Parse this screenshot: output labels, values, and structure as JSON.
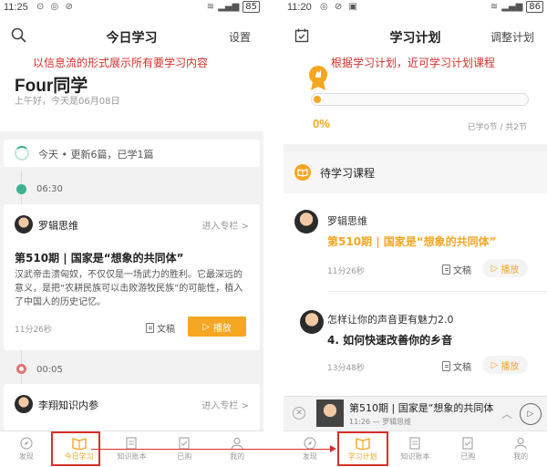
{
  "left": {
    "status": {
      "time": "11:25",
      "battery": "85"
    },
    "nav": {
      "title": "今日学习",
      "right": "设置"
    },
    "annotation": "以信息流的形式展示所有要学习内容",
    "greeting": {
      "name": "Four同学",
      "sub": "上午好，今天是06月08日"
    },
    "update_text": "今天 • 更新6篇，已学1篇",
    "time1": "06:30",
    "card1": {
      "author": "罗辑思维",
      "enter": "进入专栏 >",
      "title": "第510期 | 国家是“想象的共同体”",
      "desc": "汉武帝击溃匈奴，不仅仅是一场武力的胜利。它最深远的意义，是把“农耕民族可以击败游牧民族”的可能性，植入了中国人的历史记忆。",
      "duration": "11分26秒",
      "doc": "文稿",
      "play": "播放"
    },
    "time2": "00:05",
    "card2": {
      "author": "李翔知识内参",
      "enter": "进入专栏 >"
    },
    "tabs": [
      "发现",
      "今日学习",
      "知识账本",
      "已购",
      "我的"
    ]
  },
  "right": {
    "status": {
      "time": "11:20",
      "battery": "86"
    },
    "nav": {
      "title": "学习计划",
      "right": "调整计划"
    },
    "annotation": "根据学习计划，近可学习计划课程",
    "progress": {
      "percent": "0%",
      "value": 0,
      "label": "已学0节 / 共2节"
    },
    "section_title": "待学习课程",
    "items": [
      {
        "author": "罗辑思维",
        "title": "第510期 | 国家是“想象的共同体”",
        "duration": "11分26秒",
        "doc": "文稿",
        "play": "播放"
      },
      {
        "author": "怎样让你的声音更有魅力2.0",
        "title": "4. 如何快速改善你的乡音",
        "duration": "13分48秒",
        "doc": "文稿",
        "play": "播放"
      }
    ],
    "miniplayer": {
      "title": "第510期 | 国家是“想象的共同体",
      "sub": "11:26 — 罗辑思维"
    },
    "tabs": [
      "发现",
      "学习计划",
      "知识账本",
      "已购",
      "我的"
    ]
  },
  "colors": {
    "accent": "#f5a623",
    "annotation": "#d6302a",
    "green": "#3cb28e"
  }
}
